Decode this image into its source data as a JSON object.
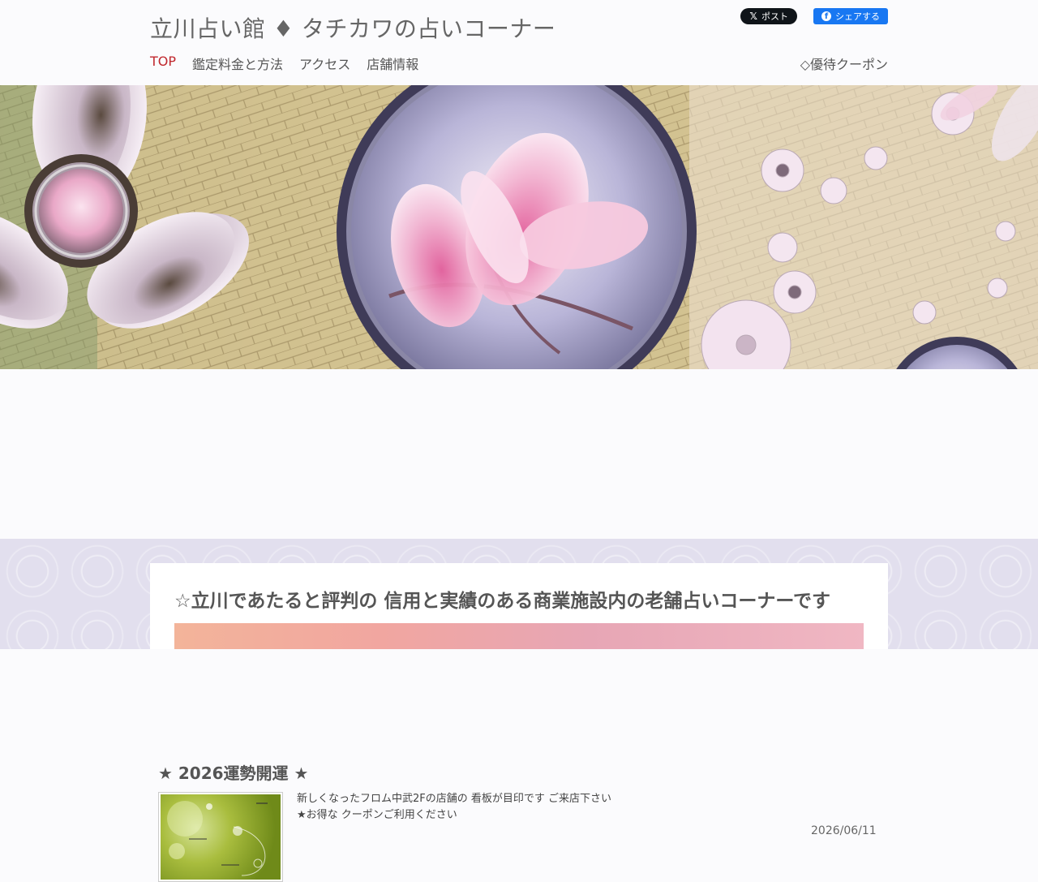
{
  "header": {
    "site_title": "立川占い館 ♦ タチカワの占いコーナー",
    "social": {
      "x_label": "ポスト",
      "fb_label": "シェアする"
    },
    "nav": [
      {
        "label": "TOP",
        "active": true
      },
      {
        "label": "鑑定料金と方法",
        "active": false
      },
      {
        "label": "アクセス",
        "active": false
      },
      {
        "label": "店舗情報",
        "active": false
      }
    ],
    "coupon_link": "◇優待クーポン"
  },
  "colors": {
    "nav_active": "#c0272d",
    "section_bg": "#e2dfee"
  },
  "news": {
    "title": "★ 2026運勢開運 ★",
    "line1": "新しくなったフロム中武2Fの店舗の 看板が目印です ご来店下さい",
    "line2": "★お得な クーポンご利用ください",
    "date": "2026/06/11"
  },
  "section": {
    "heading": "☆立川であたると評判の 信用と実績のある商業施設内の老舗占いコーナーです"
  }
}
